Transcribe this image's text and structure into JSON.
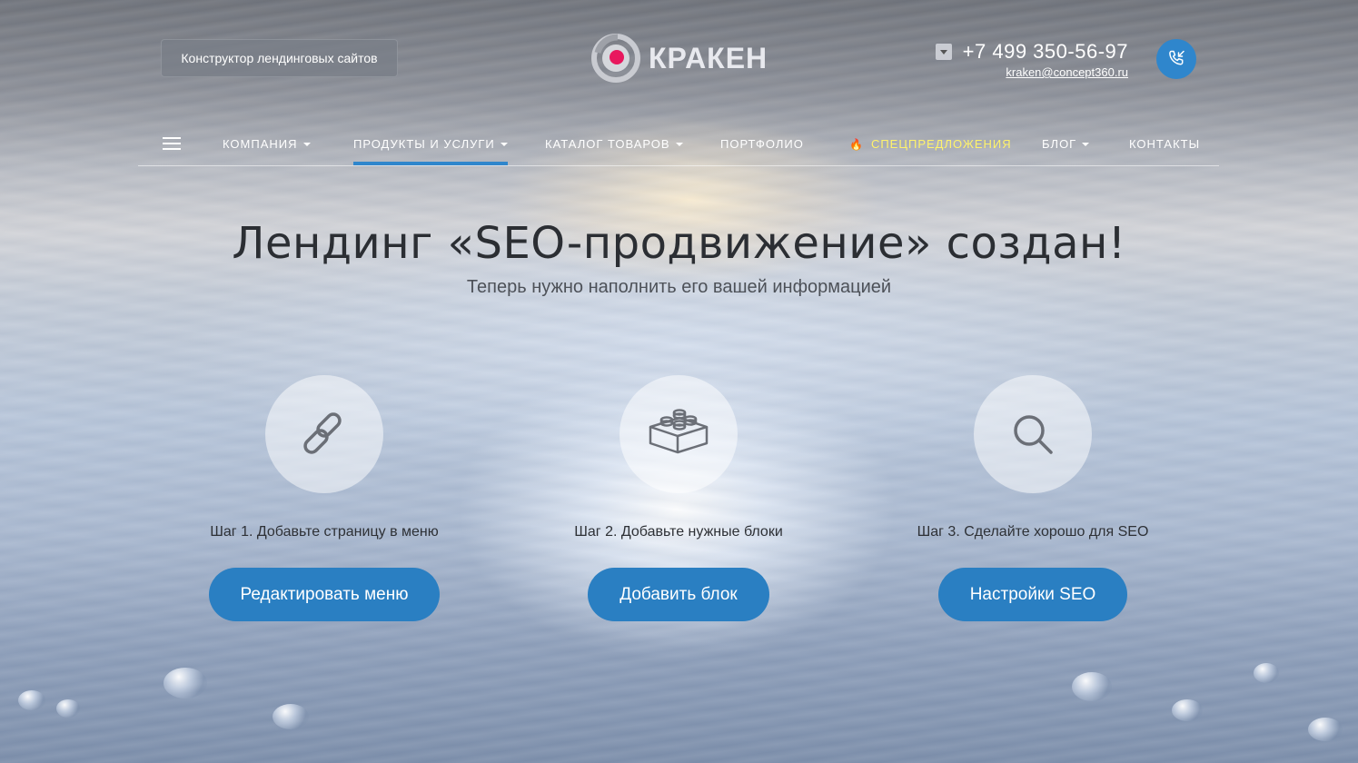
{
  "header": {
    "constructor_label": "Конструктор лендинговых сайтов",
    "logo_text": "КРАКЕН",
    "phone": "+7 499 350-56-97",
    "email": "kraken@concept360.ru"
  },
  "nav": {
    "items": [
      {
        "label": "Компания",
        "dropdown": true
      },
      {
        "label": "Продукты и услуги",
        "dropdown": true,
        "active": true
      },
      {
        "label": "Каталог товаров",
        "dropdown": true
      },
      {
        "label": "Портфолио",
        "dropdown": false
      },
      {
        "label": "Спецпредложения",
        "dropdown": false,
        "icon": "fire-icon"
      },
      {
        "label": "Блог",
        "dropdown": true
      },
      {
        "label": "Контакты",
        "dropdown": false
      }
    ]
  },
  "hero": {
    "title": "Лендинг «SEO-продвижение» создан!",
    "subtitle": "Теперь нужно наполнить его вашей информацией"
  },
  "steps": [
    {
      "icon": "link-icon",
      "text": "Шаг 1. Добавьте страницу в меню",
      "button": "Редактировать меню"
    },
    {
      "icon": "blocks-icon",
      "text": "Шаг 2. Добавьте нужные блоки",
      "button": "Добавить блок"
    },
    {
      "icon": "search-icon",
      "text": "Шаг 3. Сделайте хорошо для SEO",
      "button": "Настройки SEO"
    }
  ],
  "colors": {
    "accent": "#2a7fc2",
    "special_nav": "#fff36b",
    "logo_dot": "#e8185e"
  }
}
